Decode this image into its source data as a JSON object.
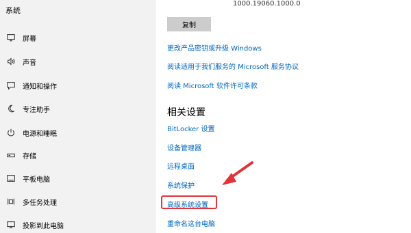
{
  "sidebar": {
    "title": "系统",
    "items": [
      {
        "label": "屏幕",
        "icon": "display-icon"
      },
      {
        "label": "声音",
        "icon": "speaker-icon"
      },
      {
        "label": "通知和操作",
        "icon": "notification-icon"
      },
      {
        "label": "专注助手",
        "icon": "moon-icon"
      },
      {
        "label": "电源和睡眠",
        "icon": "power-icon"
      },
      {
        "label": "存储",
        "icon": "storage-icon"
      },
      {
        "label": "平板电脑",
        "icon": "tablet-icon"
      },
      {
        "label": "多任务处理",
        "icon": "multitask-icon"
      },
      {
        "label": "投影到此电脑",
        "icon": "project-icon"
      }
    ]
  },
  "main": {
    "version": "1000.19060.1000.0",
    "copy_label": "复制",
    "links": [
      "更改产品密钥或升级 Windows",
      "阅读适用于我们服务的 Microsoft 服务协议",
      "阅读 Microsoft 软件许可条款"
    ],
    "related_heading": "相关设置",
    "related_links": [
      "BitLocker 设置",
      "设备管理器",
      "远程桌面",
      "系统保护",
      "高级系统设置",
      "重命名这台电脑"
    ]
  },
  "colors": {
    "link": "#0067c0",
    "sidebar_bg": "#f2f2f2",
    "highlight": "#e0333a",
    "button_bg": "#cccccc"
  }
}
